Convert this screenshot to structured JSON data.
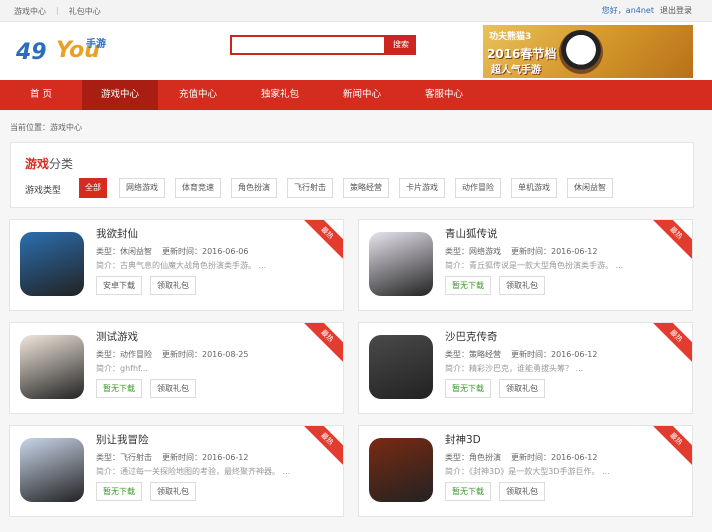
{
  "topbar": {
    "links": [
      "游戏中心",
      "礼包中心"
    ],
    "greeting": "您好，an4net",
    "logout": "退出登录"
  },
  "header": {
    "logo": {
      "number": "49",
      "you": "You",
      "tag": "手游"
    },
    "search": {
      "value": "",
      "button": "搜索"
    },
    "banner": {
      "top": "功夫熊猫3",
      "line1": "2016春节档",
      "line2": "超人气手游"
    }
  },
  "nav": {
    "items": [
      "首 页",
      "游戏中心",
      "充值中心",
      "独家礼包",
      "新闻中心",
      "客服中心"
    ],
    "active_index": 1
  },
  "breadcrumb": "当前位置：游戏中心",
  "category": {
    "heading_red": "游戏",
    "heading_rest": "分类",
    "label": "游戏类型",
    "tags": [
      "全部",
      "网络游戏",
      "体育竞速",
      "角色扮演",
      "飞行射击",
      "策略经营",
      "卡片游戏",
      "动作冒险",
      "单机游戏",
      "休闲益智"
    ],
    "active_index": 0
  },
  "games": [
    {
      "title": "我欲封仙",
      "type": "类型：休闲益智",
      "time": "更新时间：2016-06-06",
      "intro": "简介：古典气息的仙魔大战角色扮演类手游。 ...",
      "download": "安卓下载",
      "gift": "领取礼包",
      "ribbon": "最热",
      "download_green": false,
      "icon": "pvp-panda-icon",
      "color": "#2b6fb0"
    },
    {
      "title": "青山狐传说",
      "type": "类型：网络游戏",
      "time": "更新时间：2016-06-12",
      "intro": "简介：青丘狐传说是一款大型角色扮演类手游。 ...",
      "download": "暂无下载",
      "gift": "领取礼包",
      "ribbon": "最热",
      "download_green": true,
      "icon": "fox-legend-icon",
      "color": "#e8e4ee"
    },
    {
      "title": "测试游戏",
      "type": "类型：动作冒险",
      "time": "更新时间：2016-08-25",
      "intro": "简介：ghfhf...",
      "download": "暂无下载",
      "gift": "领取礼包",
      "ribbon": "最热",
      "download_green": true,
      "icon": "anime-girl-icon",
      "color": "#f1e8dc"
    },
    {
      "title": "沙巴克传奇",
      "type": "类型：策略经营",
      "time": "更新时间：2016-06-12",
      "intro": "简介：精彩沙巴克，谁能勇拔头筹？ ...",
      "download": "暂无下载",
      "gift": "领取礼包",
      "ribbon": "最热",
      "download_green": true,
      "icon": "dragon-icon",
      "color": "#4a4a4a"
    },
    {
      "title": "别让我冒险",
      "type": "类型：飞行射击",
      "time": "更新时间：2016-06-12",
      "intro": "简介：通过每一关探险地图的考验，最终聚齐神器。 ...",
      "download": "暂无下载",
      "gift": "领取礼包",
      "ribbon": "最热",
      "download_green": true,
      "icon": "adventure-hero-icon",
      "color": "#c9d6ea"
    },
    {
      "title": "封神3D",
      "type": "类型：角色扮演",
      "time": "更新时间：2016-06-12",
      "intro": "简介：《封神3D》是一款大型3D手游巨作。 ...",
      "download": "暂无下载",
      "gift": "领取礼包",
      "ribbon": "最热",
      "download_green": true,
      "icon": "fengshen-3d-icon",
      "color": "#7a2a12"
    }
  ]
}
